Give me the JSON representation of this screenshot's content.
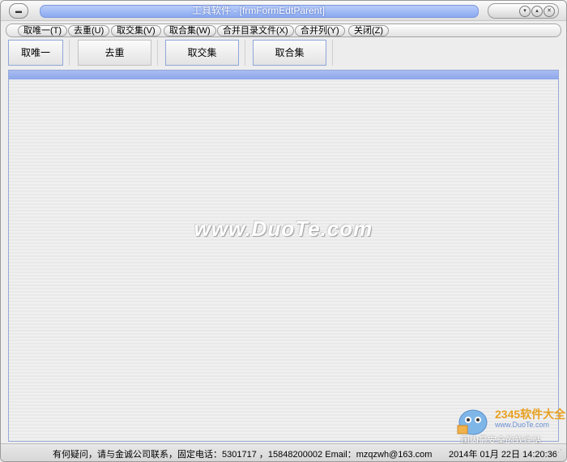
{
  "window": {
    "title": "工具软件 - [frmFormEdtParent]"
  },
  "menu": {
    "items": [
      {
        "label": "取唯一(T)"
      },
      {
        "label": "去重(U)"
      },
      {
        "label": "取交集(V)"
      },
      {
        "label": "取合集(W)"
      },
      {
        "label": "合并目录文件(X)"
      },
      {
        "label": "合并列(Y)"
      },
      {
        "label": "关闭(Z)"
      }
    ]
  },
  "toolbar": {
    "buttons": [
      {
        "label": "取唯一"
      },
      {
        "label": "去重"
      },
      {
        "label": "取交集"
      },
      {
        "label": "取合集"
      }
    ]
  },
  "content": {
    "watermark": "www.DuoTe.com"
  },
  "logo": {
    "brand": "2345软件大全",
    "url": "www.DuoTe.com",
    "slogan": "国内最安全的软件站"
  },
  "status": {
    "contact": "有何疑问，请与金诚公司联系，固定电话：5301717  ，15848200002 Email：mzqzwh@163.com",
    "datetime": "2014年 01月 22日  14:20:36"
  },
  "icons": {
    "system_menu": "system-menu-icon",
    "minimize": "minimize-icon",
    "maximize": "maximize-icon",
    "close": "close-icon",
    "grip": "resize-grip-icon"
  }
}
